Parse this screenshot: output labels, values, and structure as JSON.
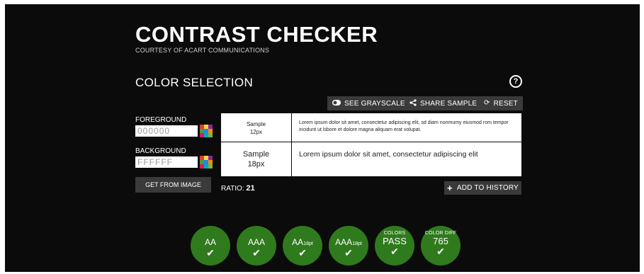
{
  "header": {
    "title": "CONTRAST CHECKER",
    "subtitle": "COURTESY OF ACART COMMUNICATIONS"
  },
  "color_selection": {
    "heading": "COLOR SELECTION",
    "help_icon": "?"
  },
  "toolbar": {
    "grayscale_label": "SEE GRAYSCALE",
    "share_label": "SHARE SAMPLE",
    "reset_label": "RESET"
  },
  "foreground": {
    "label": "FOREGROUND",
    "value": "000000"
  },
  "background": {
    "label": "BACKGROUND",
    "value": "FFFFFF"
  },
  "get_from_image_label": "GET FROM IMAGE",
  "samples": {
    "small_label_line1": "Sample",
    "small_label_line2": "12px",
    "small_text": "Lorem ipsum dolor sit amet, consectetur adipiscing elit, sd diam nonmumy eiusmod rom tempor incidunt ut lsbore et dolore magna aliquam erat volupat.",
    "large_label_line1": "Sample",
    "large_label_line2": "18px",
    "large_text": "Lorem ipsum dolor sit amet, consectetur adipiscing elit"
  },
  "ratio": {
    "label": "RATIO:",
    "value": "21"
  },
  "add_to_history_label": "ADD TO HISTORY",
  "results": [
    {
      "main": "AA",
      "suffix": "",
      "status": "✔"
    },
    {
      "main": "AAA",
      "suffix": "",
      "status": "✔"
    },
    {
      "main": "AA",
      "suffix": "18pt",
      "status": "✔"
    },
    {
      "main": "AAA",
      "suffix": "18pt",
      "status": "✔"
    }
  ],
  "colors_result": {
    "label": "COLORS",
    "value": "PASS",
    "status": "✔"
  },
  "color_diff_result": {
    "label": "COLOR DIFF",
    "value": "765",
    "status": "✔"
  },
  "colors": {
    "background": "#0b0b0b",
    "button": "#3a3a3a",
    "pass_green": "#2f7a1d"
  }
}
